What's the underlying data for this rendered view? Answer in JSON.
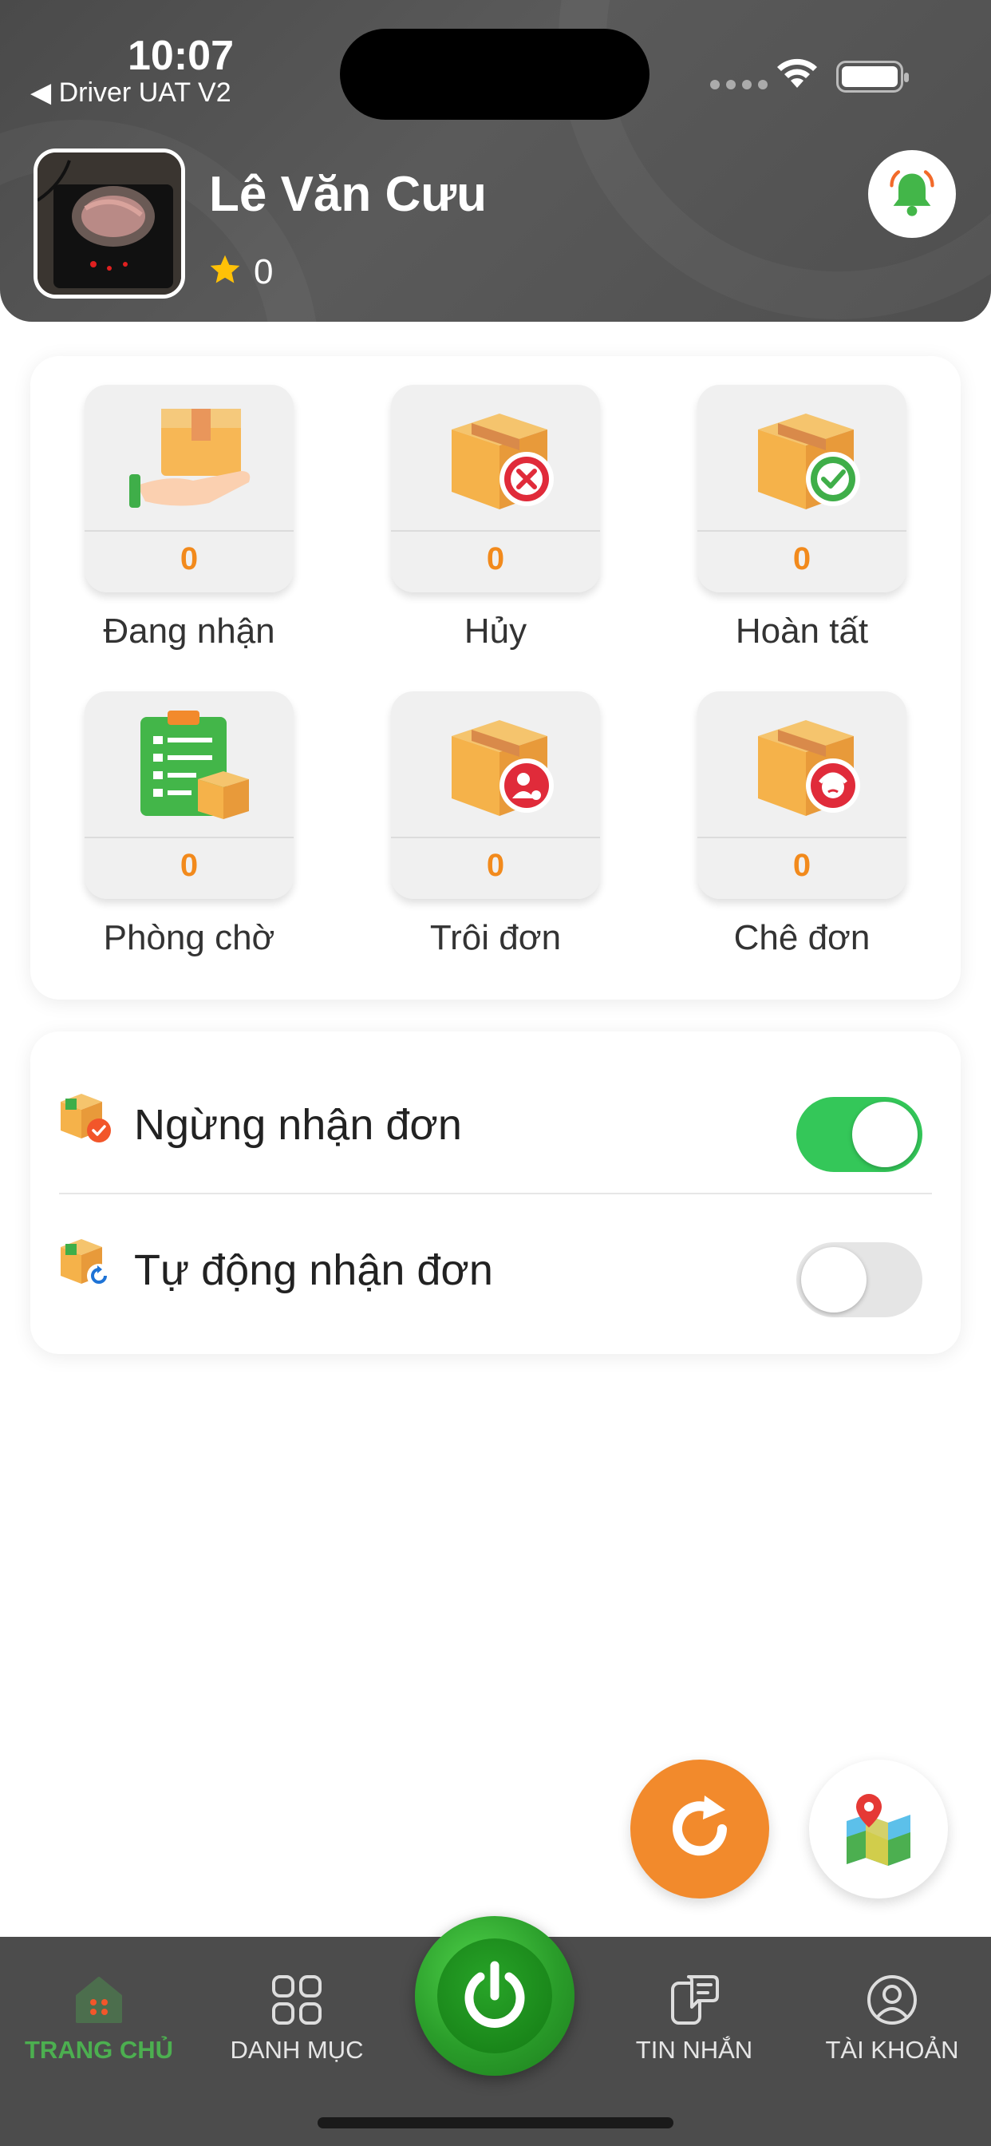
{
  "status_bar": {
    "time": "10:07",
    "back_app": "◀ Driver UAT V2"
  },
  "profile": {
    "name": "Lê Văn Cưu",
    "rating": "0",
    "avatar_icon": "avatar-photo"
  },
  "stats": [
    {
      "label": "Đang nhận",
      "count": "0",
      "icon": "hand-box-icon"
    },
    {
      "label": "Hủy",
      "count": "0",
      "icon": "box-cancel-icon"
    },
    {
      "label": "Hoàn tất",
      "count": "0",
      "icon": "box-check-icon"
    },
    {
      "label": "Phòng chờ",
      "count": "0",
      "icon": "clipboard-box-icon"
    },
    {
      "label": "Trôi đơn",
      "count": "0",
      "icon": "box-user-icon"
    },
    {
      "label": "Chê đơn",
      "count": "0",
      "icon": "box-face-icon"
    }
  ],
  "settings": [
    {
      "label": "Ngừng nhận đơn",
      "enabled": true,
      "icon": "box-check-small-icon"
    },
    {
      "label": "Tự động nhận đơn",
      "enabled": false,
      "icon": "box-refresh-small-icon"
    }
  ],
  "nav": {
    "home": "TRANG CHỦ",
    "catalog": "DANH MỤC",
    "messages": "TIN NHẮN",
    "account": "TÀI KHOẢN"
  },
  "colors": {
    "accent_orange": "#f28a1c",
    "active_green": "#4caf50",
    "toggle_on": "#34c759",
    "header_bg": "#4f4f4f"
  }
}
